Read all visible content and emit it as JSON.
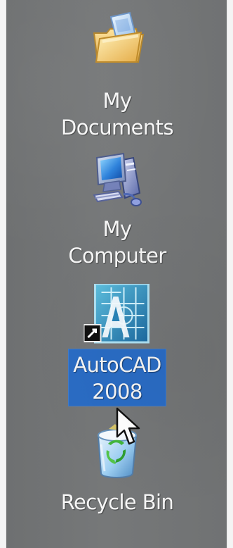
{
  "desktop": {
    "icons": [
      {
        "name": "My Documents",
        "label": "My\nDocuments",
        "icon": "folder-with-paper-icon"
      },
      {
        "name": "My Computer",
        "label": "My\nComputer",
        "icon": "computer-icon"
      },
      {
        "name": "AutoCAD 2008",
        "label": "AutoCAD\n2008",
        "icon": "autocad-icon",
        "selected": true
      },
      {
        "name": "Recycle Bin",
        "label": "Recycle Bin",
        "icon": "recycle-bin-icon"
      }
    ]
  },
  "colors": {
    "desktop_background": "#747677",
    "selection_background": "#2a6cc4",
    "label_text": "#f6f6f6"
  },
  "cursor": {
    "icon": "mouse-pointer-icon"
  }
}
